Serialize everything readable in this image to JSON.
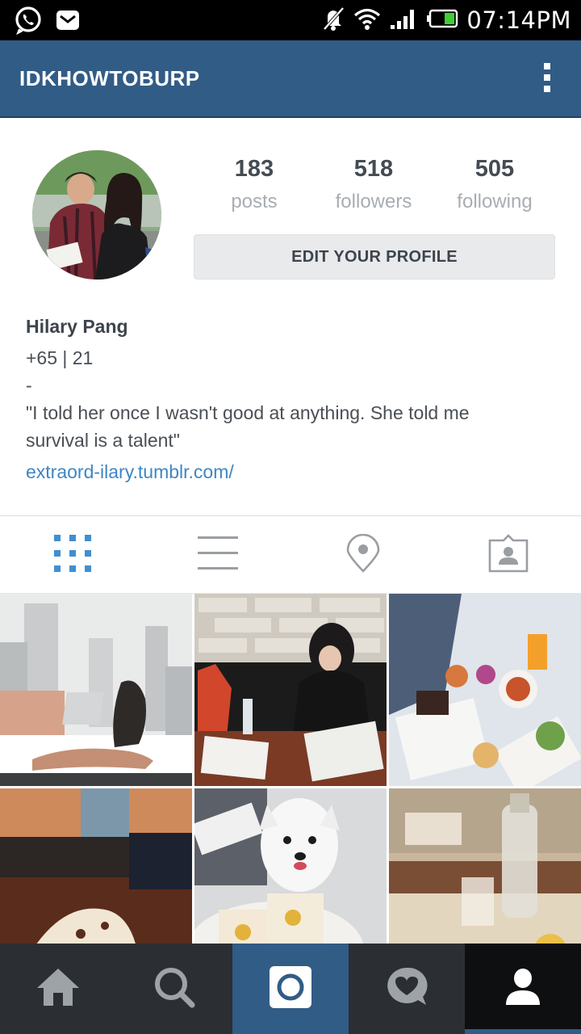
{
  "status_bar": {
    "time": "07:14PM",
    "left_icons": [
      "whatsapp-icon",
      "email-icon"
    ],
    "right_icons": [
      "silent-icon",
      "wifi-icon",
      "signal-icon",
      "battery-icon"
    ]
  },
  "action_bar": {
    "username": "IDKHOWTOBURP",
    "menu_icon": "overflow-menu-icon"
  },
  "profile": {
    "stats": [
      {
        "value": "183",
        "label": "posts"
      },
      {
        "value": "518",
        "label": "followers"
      },
      {
        "value": "505",
        "label": "following"
      }
    ],
    "edit_button_label": "EDIT YOUR PROFILE"
  },
  "bio": {
    "name": "Hilary Pang",
    "line1": "+65 | 21",
    "line2": "-",
    "quote_line1": "\"I told her once I wasn't good at anything. She told me",
    "quote_line2": "survival is a talent\"",
    "website": "extraord-ilary.tumblr.com/"
  },
  "view_tabs": [
    {
      "name": "grid-view",
      "icon": "grid-icon",
      "active": true
    },
    {
      "name": "list-view",
      "icon": "list-icon",
      "active": false
    },
    {
      "name": "map-view",
      "icon": "location-pin-icon",
      "active": false
    },
    {
      "name": "tagged-photos",
      "icon": "tagged-person-icon",
      "active": false
    }
  ],
  "bottom_nav": [
    {
      "name": "home",
      "icon": "home-icon"
    },
    {
      "name": "search",
      "icon": "search-icon"
    },
    {
      "name": "camera",
      "icon": "camera-icon"
    },
    {
      "name": "activity",
      "icon": "heart-bubble-icon"
    },
    {
      "name": "profile",
      "icon": "person-icon",
      "active": true
    }
  ],
  "colors": {
    "brand_blue": "#315c86",
    "link_blue": "#3f86c4",
    "active_tab_blue": "#3f8fd2"
  }
}
